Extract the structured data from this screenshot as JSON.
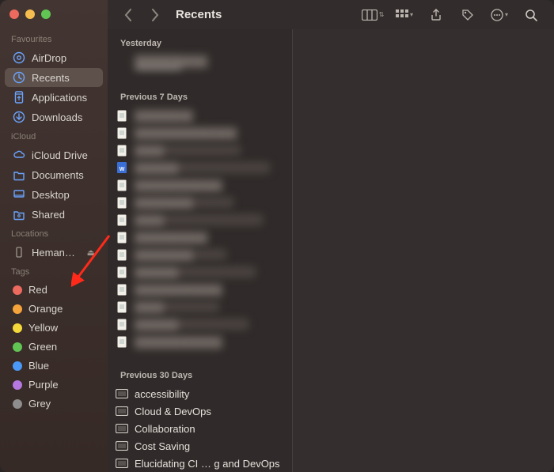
{
  "traffic": {
    "close": "#ec6a5e",
    "min": "#f5bd4f",
    "max": "#61c554"
  },
  "sidebar": {
    "sections": [
      {
        "label": "Favourites",
        "kind": "fav",
        "items": [
          {
            "icon": "airdrop",
            "label": "AirDrop"
          },
          {
            "icon": "recents",
            "label": "Recents",
            "active": true
          },
          {
            "icon": "apps",
            "label": "Applications"
          },
          {
            "icon": "download",
            "label": "Downloads"
          }
        ]
      },
      {
        "label": "iCloud",
        "kind": "fav",
        "items": [
          {
            "icon": "icloud",
            "label": "iCloud Drive"
          },
          {
            "icon": "folder",
            "label": "Documents"
          },
          {
            "icon": "desktop",
            "label": "Desktop"
          },
          {
            "icon": "shared",
            "label": "Shared"
          }
        ]
      },
      {
        "label": "Locations",
        "kind": "loc",
        "items": [
          {
            "icon": "device",
            "label": "Heman…",
            "eject": true
          }
        ]
      },
      {
        "label": "Tags",
        "kind": "tags",
        "items": [
          {
            "color": "#ec6a5e",
            "label": "Red"
          },
          {
            "color": "#f5a33b",
            "label": "Orange"
          },
          {
            "color": "#f5d93b",
            "label": "Yellow"
          },
          {
            "color": "#61c554",
            "label": "Green"
          },
          {
            "color": "#4a98f7",
            "label": "Blue"
          },
          {
            "color": "#b578e0",
            "label": "Purple"
          },
          {
            "color": "#8e8e8e",
            "label": "Grey"
          }
        ]
      }
    ]
  },
  "toolbar": {
    "title": "Recents",
    "view_icon": "columns",
    "group_icon": "grid",
    "share_icon": "share",
    "tag_icon": "tag",
    "more_icon": "ellipsis",
    "search_icon": "search"
  },
  "groups": [
    {
      "label": "Yesterday",
      "rows": [
        {
          "icon": "none",
          "blur": true,
          "first": true,
          "text": "██████████"
        }
      ]
    },
    {
      "label": "Previous 7 Days",
      "rows": [
        {
          "icon": "page",
          "blur": true,
          "text": "████████"
        },
        {
          "icon": "page",
          "blur": true,
          "text": "██████████████"
        },
        {
          "icon": "page",
          "blur": true,
          "text": "████"
        },
        {
          "icon": "docx",
          "blur": true,
          "text": "██████"
        },
        {
          "icon": "page",
          "blur": true,
          "text": "████████████"
        },
        {
          "icon": "page",
          "blur": true,
          "text": "████████"
        },
        {
          "icon": "page",
          "blur": true,
          "text": "████"
        },
        {
          "icon": "page",
          "blur": true,
          "text": "██████████"
        },
        {
          "icon": "page",
          "blur": true,
          "text": "████████"
        },
        {
          "icon": "page",
          "blur": true,
          "text": "██████"
        },
        {
          "icon": "page",
          "blur": true,
          "text": "████████████"
        },
        {
          "icon": "page",
          "blur": true,
          "text": "████"
        },
        {
          "icon": "page",
          "blur": true,
          "text": "██████"
        },
        {
          "icon": "page",
          "blur": true,
          "text": "████████████"
        }
      ]
    },
    {
      "label": "Previous 30 Days",
      "rows": [
        {
          "icon": "proj",
          "text": "accessibility"
        },
        {
          "icon": "proj",
          "text": "Cloud & DevOps"
        },
        {
          "icon": "proj",
          "text": "Collaboration"
        },
        {
          "icon": "proj",
          "text": "Cost Saving"
        },
        {
          "icon": "proj",
          "text": "Elucidating CI … g and DevOps"
        }
      ]
    }
  ]
}
